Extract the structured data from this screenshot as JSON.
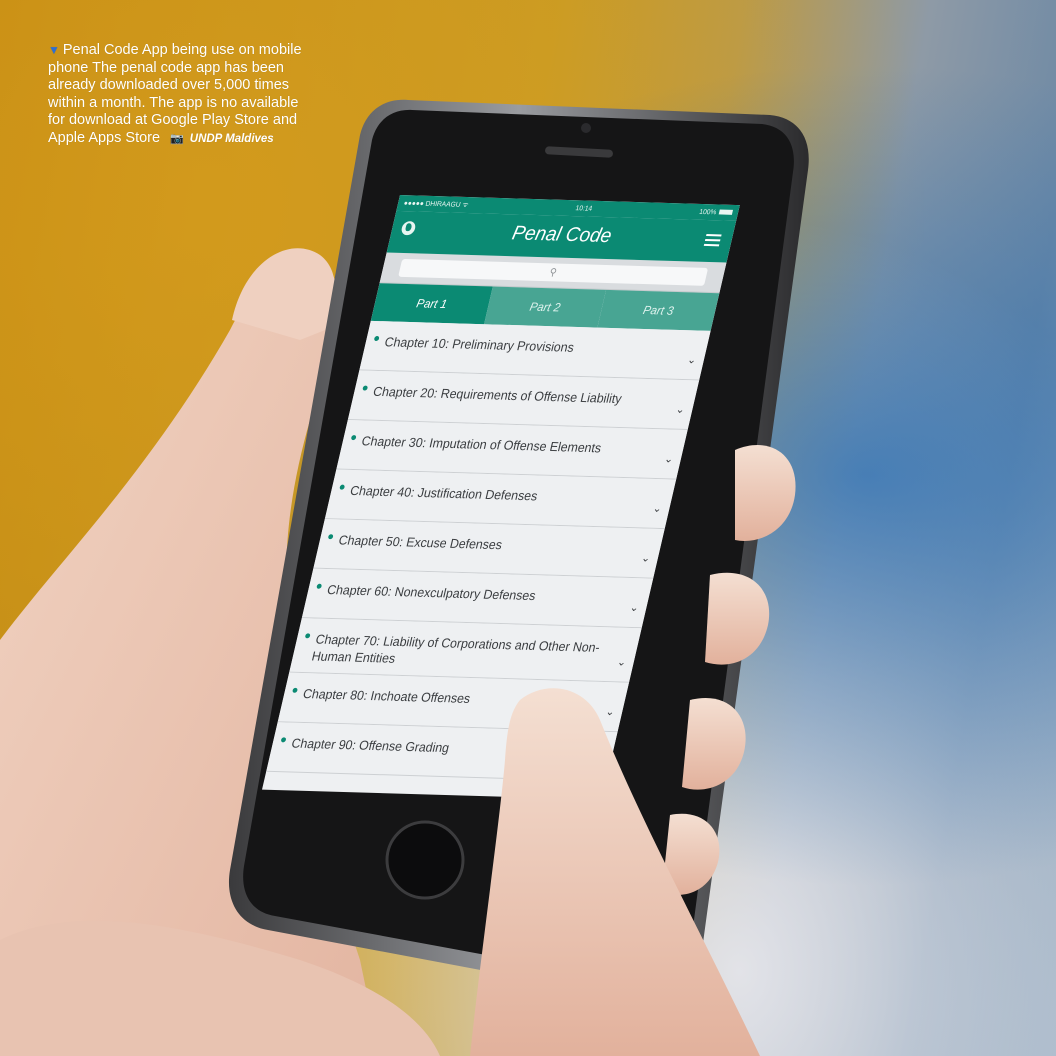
{
  "caption": {
    "marker": "▼",
    "text": "Penal Code App being use on mobile phone The penal code app has been already downloaded over 5,000 times within a month. The app is no available for download at Google Play Store and Apple Apps Store",
    "camera_icon": "camera-icon",
    "credit": "UNDP Maldives"
  },
  "phone": {
    "status_bar": {
      "carrier": "●●●●● DHIRAAGU ᯤ",
      "time": "10:14",
      "battery": "100%"
    },
    "app_bar": {
      "title": "Penal Code",
      "left_icon": "globe-icon",
      "right_icon": "menu-icon"
    },
    "search": {
      "icon": "search-icon",
      "glyph": "⚲"
    },
    "tabs": [
      {
        "label": "Part 1",
        "active": true
      },
      {
        "label": "Part 2",
        "active": false
      },
      {
        "label": "Part 3",
        "active": false
      }
    ],
    "chapters": [
      {
        "label": "Chapter 10: Preliminary Provisions"
      },
      {
        "label": "Chapter 20: Requirements of Offense Liability"
      },
      {
        "label": "Chapter 30: Imputation of Offense Elements"
      },
      {
        "label": "Chapter 40: Justification Defenses"
      },
      {
        "label": "Chapter 50: Excuse Defenses"
      },
      {
        "label": "Chapter 60: Nonexculpatory Defenses"
      },
      {
        "label": "Chapter 70: Liability of Corporations and Other Non-Human Entities"
      },
      {
        "label": "Chapter 80: Inchoate Offenses"
      },
      {
        "label": "Chapter 90: Offense Grading"
      }
    ],
    "chevron": "⌄"
  },
  "colors": {
    "app_green": "#0b8a73",
    "tab_inactive": "#48a593",
    "caption_marker": "#2f6fd0",
    "background_yellow": "#c28a12",
    "background_blue": "#286eb4"
  }
}
